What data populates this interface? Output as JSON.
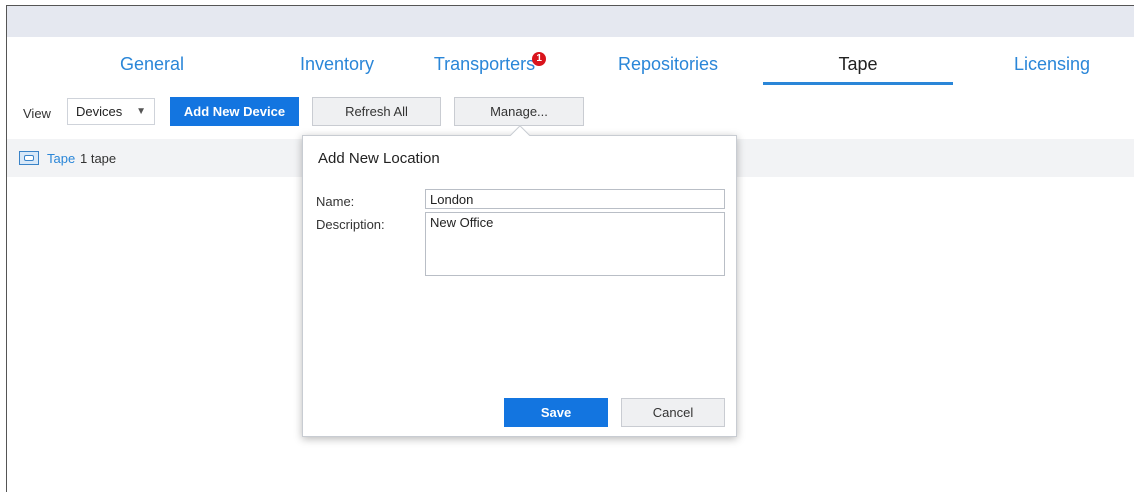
{
  "tabs": [
    {
      "label": "General"
    },
    {
      "label": "Inventory"
    },
    {
      "label": "Transporters",
      "badge": "1"
    },
    {
      "label": "Repositories"
    },
    {
      "label": "Tape"
    },
    {
      "label": "Licensing"
    }
  ],
  "active_tab": "Tape",
  "toolbar": {
    "view_label": "View",
    "view_selected": "Devices",
    "add_device_label": "Add New Device",
    "refresh_label": "Refresh All",
    "manage_label": "Manage..."
  },
  "infobar": {
    "tape_link": "Tape",
    "tape_count": "1 tape"
  },
  "dialog": {
    "title": "Add New Location",
    "name_label": "Name:",
    "name_value": "London",
    "description_label": "Description:",
    "description_value": "New Office",
    "save_label": "Save",
    "cancel_label": "Cancel"
  },
  "colors": {
    "accent": "#2a86d8",
    "primary_button": "#1375e0",
    "badge": "#d9141c",
    "topbar": "#e5e8f0"
  },
  "icons": [
    "tape-icon",
    "chevron-down-icon"
  ]
}
